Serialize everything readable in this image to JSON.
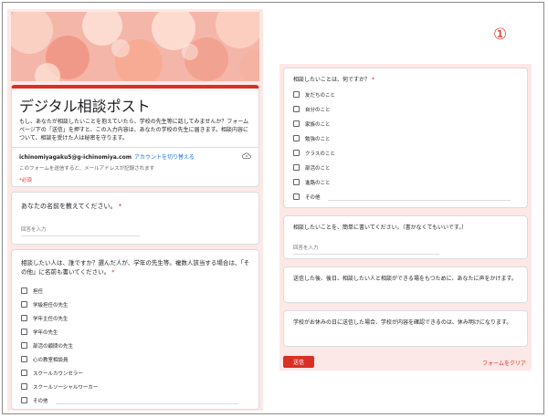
{
  "annotation": {
    "marker": "①"
  },
  "header": {
    "title": "デジタル相談ポスト",
    "description": "もし、あなたが相談したいことを抱えていたら、学校の先生等に話してみませんか？フォームページ下の「送信」を押すと、この入力内容は、あなたの学校の先生に届きます。相談内容について、相談を受けた人は秘密を守ります。",
    "account_email": "ichinomiyagaku5@g-ichinomiya.com",
    "switch_account": "アカウントを切り替える",
    "email_notice": "このフォームを送信すると、メールアドレスが記録されます",
    "required_notice": "*必須"
  },
  "questions": {
    "name": {
      "title": "あなたの名前を教えてください。",
      "required_mark": "*",
      "placeholder": "回答を入力"
    },
    "who": {
      "title": "相談したい人は、誰ですか？選んだ人が、学年の先生等。複数人該当する場合は、「その他」に名前も書いてください。",
      "required_mark": "*",
      "options": [
        "担任",
        "学級担任の先生",
        "学年主任の先生",
        "学年の先生",
        "部活の顧問の先生",
        "心の教室相談員",
        "スクールカウンセラー",
        "スクールソーシャルワーカー",
        "その他"
      ]
    },
    "topic": {
      "title": "相談したいことは、何ですか？",
      "required_mark": "*",
      "options": [
        "友だちのこと",
        "自分のこと",
        "家族のこと",
        "勉強のこと",
        "クラスのこと",
        "部活のこと",
        "進路のこと",
        "その他"
      ]
    },
    "detail": {
      "title": "相談したいことを、簡単に書いてください。（書かなくてもいいです。）",
      "placeholder": "回答を入力"
    },
    "info1": {
      "text": "送信した後、後日、相談したい人と相談ができる場をもつために、あなたに声をかけます。"
    },
    "info2": {
      "text": "学校がお休みの日に送信した場合、学校が内容を確認できるのは、休み明けになります。"
    }
  },
  "footer": {
    "submit_label": "送信",
    "clear_label": "フォームをクリア"
  },
  "colors": {
    "accent": "#d93025",
    "background": "#fce8e6",
    "link": "#1a73e8"
  },
  "icons": {
    "account": "cloud-icon"
  }
}
